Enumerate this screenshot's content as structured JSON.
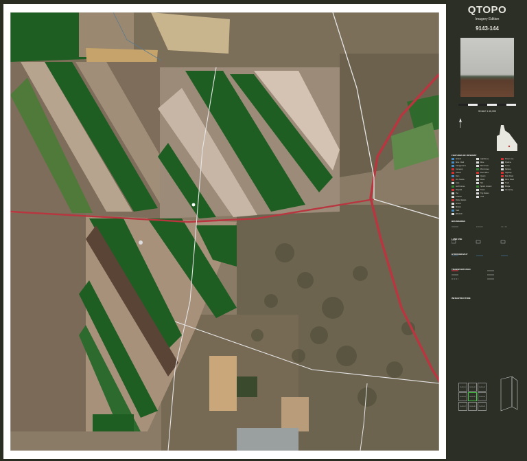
{
  "title": {
    "main": "QTOPO",
    "sub": "Imagery Edition",
    "sheet": "9143-144"
  },
  "scale": {
    "text": "SCALE 1:15,000"
  },
  "legend_sections": [
    "FEATURES OF INTEREST",
    "BOUNDARIES",
    "LAND USE",
    "HYDROGRAPHY",
    "TRANSPORTATION",
    "INFRASTRUCTURE"
  ],
  "legend_items_left": [
    "Airfield",
    "Bore / Well",
    "Campground",
    "Cemetery",
    "Church",
    "Dam",
    "Fire Station",
    "Gate",
    "Golf Course",
    "Hospital",
    "Hut",
    "Lookout",
    "Police Station",
    "School",
    "Shelter",
    "Tank",
    "Windmill"
  ],
  "legend_items_mid": [
    "Lighthouse",
    "Mine",
    "Monument",
    "Picnic Area",
    "Post Office",
    "Quarry",
    "Ruins",
    "Silo",
    "Sports Ground",
    "Tower",
    "Trig Station",
    "Yard"
  ],
  "legend_items_right": [
    "Power Line",
    "Pipeline",
    "Fence",
    "Railway",
    "Highway",
    "Main Road",
    "Minor Road",
    "Track",
    "Bridge",
    "Causeway"
  ],
  "sheet_index": [
    "9143-141",
    "9143-142",
    "9143-143",
    "9143-144",
    "9143-145",
    "9143-146",
    "9143-147",
    "9143-148",
    "9143-149"
  ],
  "colors": {
    "panel": "#2c2f26",
    "road_major": "#b8363f",
    "crop_green": "#1f5e22",
    "road_white": "#e8e8e8"
  }
}
